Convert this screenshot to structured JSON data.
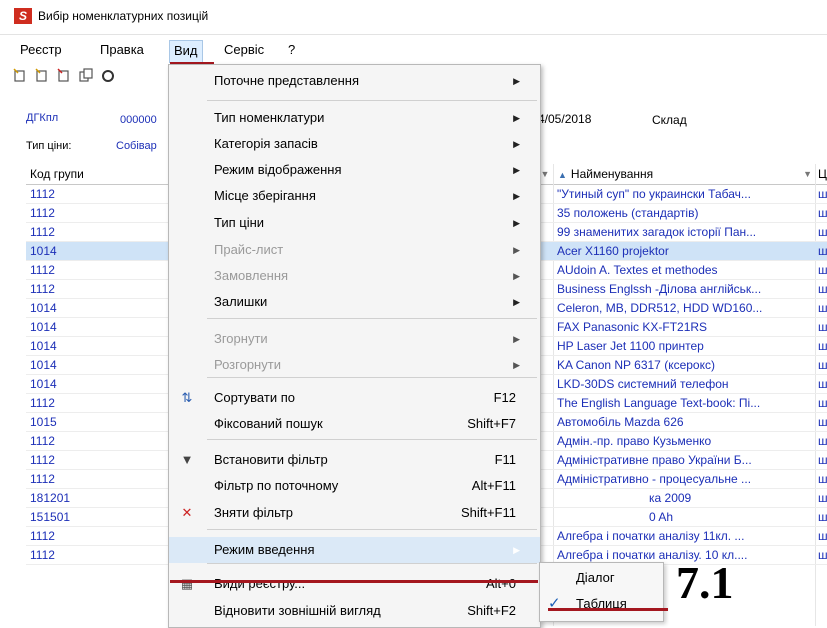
{
  "window": {
    "title": "Вибір номенклатурних позицій",
    "icon_letter": "S"
  },
  "menubar": {
    "items": [
      "Реєстр",
      "Правка",
      "Вид",
      "Сервіс",
      "?"
    ]
  },
  "header": {
    "doc_code": "ДГКпл",
    "doc_number_partial": "000000",
    "date_partial": "4/05/2018",
    "warehouse_label": "Склад",
    "price_type_label": "Тип ціни:",
    "price_type_value_partial": "Собівар"
  },
  "grid": {
    "col_code_header": "Код групи",
    "col_name_header": "Найменування",
    "col_u_header": "Ц",
    "codes": [
      "1112",
      "1112",
      "1112",
      "1014",
      "1112",
      "1112",
      "1014",
      "1014",
      "1014",
      "1014",
      "1014",
      "1112",
      "1015",
      "1112",
      "1112",
      "1112",
      "181201",
      "151501",
      "1112",
      "1112"
    ],
    "names": [
      "\"Утиный суп\" по украински Табач...",
      "35 положень (стандартів)",
      "99 знаменитих загадок історії Пан...",
      "Acer X1160 projektor",
      "AUdoin A. Textes et methodes",
      "Business Englssh -Ділова англійськ...",
      "Celeron, MB, DDR512, HDD WD160...",
      "FAX Panasonic KX-FT21RS",
      "HP Laser Jet 1100 принтер",
      "KA Canon NP 6317 (ксерокс)",
      "LKD-30DS системний телефон",
      "The English Language Text-book: Пі...",
      "Автомобіль Mazda 626",
      "Адмін.-пр. право Кузьменко",
      "Адміністративне право України Б...",
      "Адміністративно - процесуальне ...",
      "ка 2009",
      "0 Ah",
      "Алгебра і початки аналізу 11кл. ...",
      "Алгебра і початки аналізу. 10 кл...."
    ],
    "u_marks": [
      "ш",
      "ш",
      "ш",
      "ш",
      "ш",
      "ш",
      "ш",
      "ш",
      "ш",
      "ш",
      "ш",
      "ш",
      "ш",
      "ш",
      "ш",
      "ш",
      "ш",
      "ш",
      "ш",
      "ш"
    ]
  },
  "dropdown": {
    "items": [
      {
        "label": "Поточне представлення",
        "shortcut": "",
        "submenu": true,
        "disabled": false,
        "icon": ""
      },
      {
        "label": "Тип номенклатури",
        "shortcut": "",
        "submenu": true,
        "disabled": false,
        "icon": ""
      },
      {
        "label": "Категорія запасів",
        "shortcut": "",
        "submenu": true,
        "disabled": false,
        "icon": ""
      },
      {
        "label": "Режим відображення",
        "shortcut": "",
        "submenu": true,
        "disabled": false,
        "icon": ""
      },
      {
        "label": "Місце зберігання",
        "shortcut": "",
        "submenu": true,
        "disabled": false,
        "icon": ""
      },
      {
        "label": "Тип ціни",
        "shortcut": "",
        "submenu": true,
        "disabled": false,
        "icon": ""
      },
      {
        "label": "Прайс-лист",
        "shortcut": "",
        "submenu": true,
        "disabled": true,
        "icon": ""
      },
      {
        "label": "Замовлення",
        "shortcut": "",
        "submenu": true,
        "disabled": true,
        "icon": ""
      },
      {
        "label": "Залишки",
        "shortcut": "",
        "submenu": true,
        "disabled": false,
        "icon": ""
      },
      {
        "label": "Згорнути",
        "shortcut": "",
        "submenu": true,
        "disabled": true,
        "icon": ""
      },
      {
        "label": "Розгорнути",
        "shortcut": "",
        "submenu": true,
        "disabled": true,
        "icon": ""
      },
      {
        "label": "Сортувати по",
        "shortcut": "F12",
        "submenu": false,
        "disabled": false,
        "icon": "sort-icon"
      },
      {
        "label": "Фіксований пошук",
        "shortcut": "Shift+F7",
        "submenu": false,
        "disabled": false,
        "icon": ""
      },
      {
        "label": "Встановити фільтр",
        "shortcut": "F11",
        "submenu": false,
        "disabled": false,
        "icon": "filter-icon"
      },
      {
        "label": "Фільтр по поточному",
        "shortcut": "Alt+F11",
        "submenu": false,
        "disabled": false,
        "icon": ""
      },
      {
        "label": "Зняти фільтр",
        "shortcut": "Shift+F11",
        "submenu": false,
        "disabled": false,
        "icon": "clear-filter-icon"
      },
      {
        "label": "Режим введення",
        "shortcut": "",
        "submenu": true,
        "disabled": false,
        "icon": ""
      },
      {
        "label": "Види реєстру...",
        "shortcut": "Alt+0",
        "submenu": false,
        "disabled": false,
        "icon": "registry-views-icon"
      },
      {
        "label": "Відновити зовнішній вигляд",
        "shortcut": "Shift+F2",
        "submenu": false,
        "disabled": false,
        "icon": ""
      }
    ]
  },
  "submenu": {
    "items": [
      "Діалог",
      "Таблиця"
    ],
    "checked_index": 1
  },
  "annotation": {
    "step_label": "7.1"
  },
  "colors": {
    "accent_underline": "#a4171f",
    "link_blue": "#1c2fb7",
    "selection": "#cfe3f7",
    "app_icon": "#cf2d1f"
  }
}
